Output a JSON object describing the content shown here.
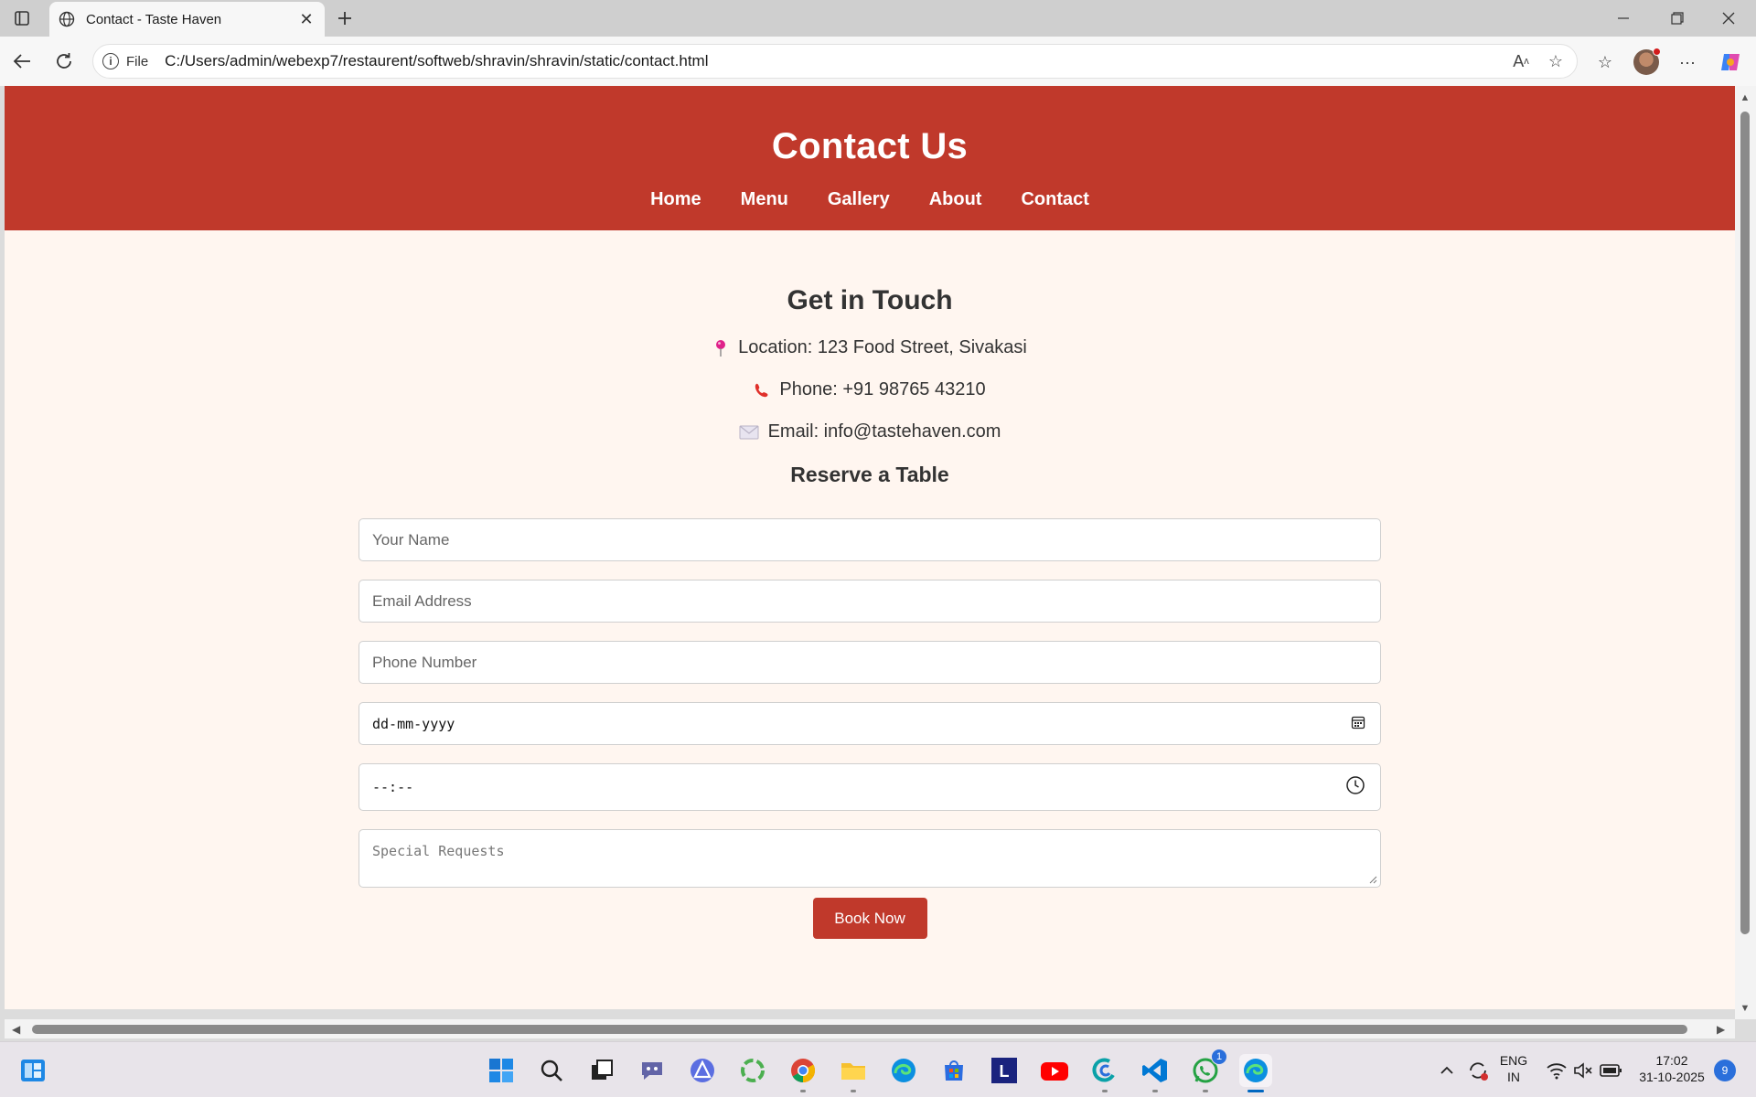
{
  "browser": {
    "tab_title": "Contact - Taste Haven",
    "file_label": "File",
    "url": "C:/Users/admin/webexp7/restaurent/softweb/shravin/shravin/static/contact.html"
  },
  "site": {
    "title": "Contact Us",
    "nav": [
      "Home",
      "Menu",
      "Gallery",
      "About",
      "Contact"
    ],
    "accent_color": "#c0392b",
    "page_bg": "#fff6f0"
  },
  "contact": {
    "heading": "Get in Touch",
    "location": "Location: 123 Food Street, Sivakasi",
    "phone": "Phone: +91 98765 43210",
    "email": "Email: info@tastehaven.com",
    "reserve_heading": "Reserve a Table"
  },
  "form": {
    "name_placeholder": "Your Name",
    "email_placeholder": "Email Address",
    "phone_placeholder": "Phone Number",
    "date_placeholder": "dd-mm-yyyy",
    "time_placeholder": "--:--",
    "requests_placeholder": "Special Requests",
    "submit_label": "Book Now"
  },
  "taskbar": {
    "lang_line1": "ENG",
    "lang_line2": "IN",
    "time": "17:02",
    "date": "31-10-2025",
    "notification_count": "9",
    "whatsapp_badge": "1",
    "apps": [
      "start",
      "search",
      "task-view",
      "teams",
      "app-a",
      "app-ring",
      "chrome",
      "file-explorer",
      "edge",
      "store",
      "app-l",
      "youtube",
      "app-c",
      "vscode",
      "whatsapp",
      "edge-active"
    ]
  }
}
